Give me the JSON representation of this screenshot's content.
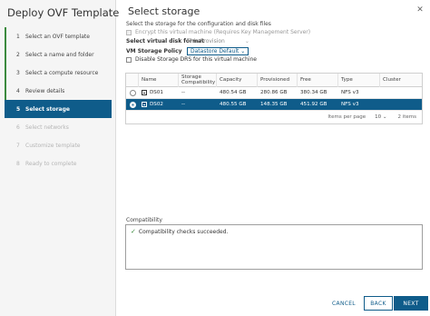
{
  "wizard": {
    "title": "Deploy OVF Template",
    "steps": [
      {
        "num": "1",
        "label": "Select an OVF template"
      },
      {
        "num": "2",
        "label": "Select a name and folder"
      },
      {
        "num": "3",
        "label": "Select a compute resource"
      },
      {
        "num": "4",
        "label": "Review details"
      },
      {
        "num": "5",
        "label": "Select storage"
      },
      {
        "num": "6",
        "label": "Select networks"
      },
      {
        "num": "7",
        "label": "Customize template"
      },
      {
        "num": "8",
        "label": "Ready to complete"
      }
    ]
  },
  "page": {
    "title": "Select storage",
    "subtitle": "Select the storage for the configuration and disk files",
    "encrypt_label": "Encrypt this virtual machine (Requires Key Management Server)",
    "disk_format_label": "Select virtual disk format",
    "disk_format_value": "Thin Provision",
    "policy_label": "VM Storage Policy",
    "policy_value": "Datastore Default",
    "drs_label": "Disable Storage DRS for this virtual machine"
  },
  "table": {
    "headers": {
      "name": "Name",
      "compat": "Storage Compatibility",
      "capacity": "Capacity",
      "provisioned": "Provisioned",
      "free": "Free",
      "type": "Type",
      "cluster": "Cluster"
    },
    "rows": [
      {
        "name": "DS01",
        "compat": "--",
        "capacity": "480.54 GB",
        "provisioned": "280.86 GB",
        "free": "380.34 GB",
        "type": "NFS v3",
        "cluster": ""
      },
      {
        "name": "DS02",
        "compat": "--",
        "capacity": "480.55 GB",
        "provisioned": "148.35 GB",
        "free": "451.92 GB",
        "type": "NFS v3",
        "cluster": ""
      }
    ],
    "items_per_page_label": "Items per page",
    "items_per_page_value": "10",
    "items_count": "2 items"
  },
  "compatibility": {
    "label": "Compatibility",
    "message": "Compatibility checks succeeded."
  },
  "buttons": {
    "cancel": "CANCEL",
    "back": "BACK",
    "next": "NEXT"
  },
  "colors": {
    "accent": "#0f5c8a",
    "completed": "#3b8a3e"
  }
}
